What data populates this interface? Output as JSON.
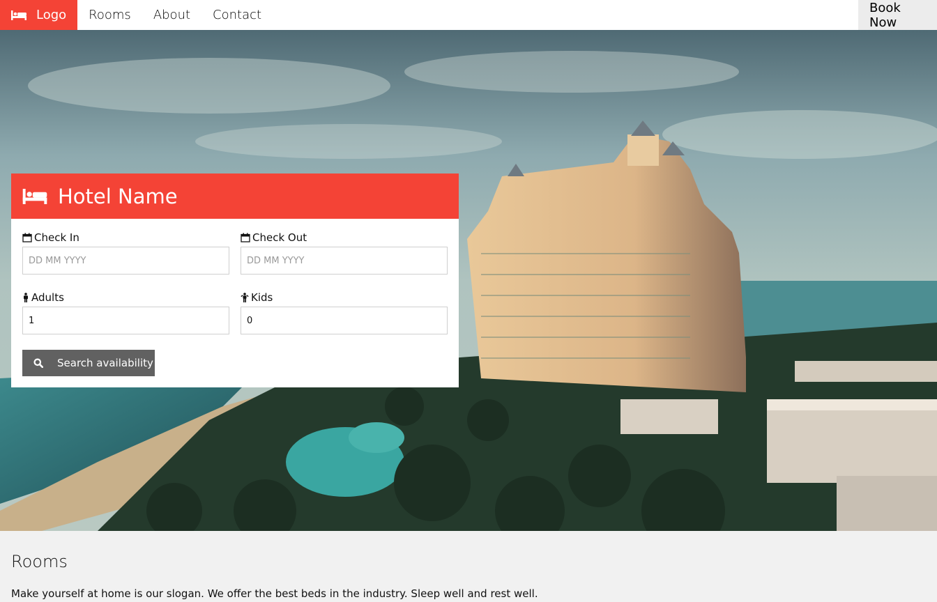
{
  "navbar": {
    "logo_label": "Logo",
    "links": [
      "Rooms",
      "About",
      "Contact"
    ],
    "book_label": "Book Now"
  },
  "booking": {
    "title": "Hotel Name",
    "check_in": {
      "label": "Check In",
      "placeholder": "DD MM YYYY"
    },
    "check_out": {
      "label": "Check Out",
      "placeholder": "DD MM YYYY"
    },
    "adults": {
      "label": "Adults",
      "value": "1"
    },
    "kids": {
      "label": "Kids",
      "value": "0"
    },
    "search_label": "Search availability"
  },
  "rooms": {
    "title": "Rooms",
    "text": "Make yourself at home is our slogan. We offer the best beds in the industry. Sleep well and rest well."
  },
  "colors": {
    "accent": "#f44336",
    "button": "#616161",
    "page_bg": "#f1f1f1"
  },
  "icons": [
    "bed-icon",
    "calendar-icon",
    "male-icon",
    "child-icon",
    "search-icon"
  ]
}
